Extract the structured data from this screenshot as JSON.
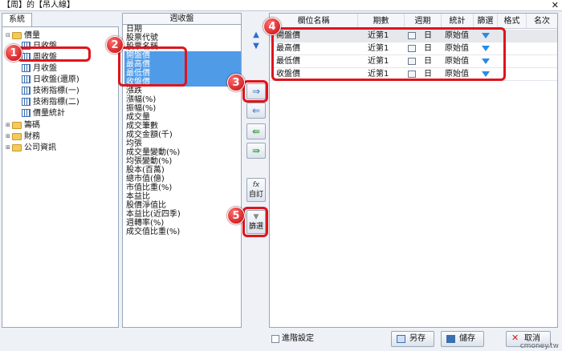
{
  "window": {
    "title": "【周】的【吊人線】",
    "close": "✕"
  },
  "tree": {
    "tab": "系統",
    "nodes": [
      {
        "label": "價量",
        "kind": "folder",
        "expand": "⊟"
      },
      {
        "label": "日收盤",
        "kind": "item"
      },
      {
        "label": "周收盤",
        "kind": "item"
      },
      {
        "label": "月收盤",
        "kind": "item"
      },
      {
        "label": "日收盤(還原)",
        "kind": "item"
      },
      {
        "label": "技術指標(一)",
        "kind": "item"
      },
      {
        "label": "技術指標(二)",
        "kind": "item"
      },
      {
        "label": "價量統計",
        "kind": "item"
      },
      {
        "label": "籌碼",
        "kind": "folder",
        "expand": "⊞"
      },
      {
        "label": "財務",
        "kind": "folder",
        "expand": "⊞"
      },
      {
        "label": "公司資訊",
        "kind": "folder",
        "expand": "⊞"
      }
    ]
  },
  "middle": {
    "header": "週收盤",
    "items": [
      "日期",
      "股票代號",
      "股票名稱",
      "開盤價",
      "最高價",
      "最低價",
      "收盤價",
      "漲跌",
      "漲幅(%)",
      "振幅(%)",
      "成交量",
      "成交筆數",
      "成交金額(千)",
      "均張",
      "成交量變動(%)",
      "均張變動(%)",
      "股本(百萬)",
      "總市值(億)",
      "市值比重(%)",
      "本益比",
      "股價淨值比",
      "本益比(近四季)",
      "週轉率(%)",
      "成交值比重(%)"
    ]
  },
  "buttons": {
    "up": "▲",
    "down": "▼",
    "add": "⇒",
    "remove": "⇐",
    "add_all": "⇚",
    "remove_all": "⇛",
    "custom_icon": "fx",
    "custom": "自訂",
    "filter_icon": "▼",
    "filter": "篩選"
  },
  "grid": {
    "headers": [
      "欄位名稱",
      "期數",
      "週期",
      "統計",
      "篩選",
      "格式",
      "名次"
    ],
    "rows": [
      {
        "name": "開盤價",
        "period": "近第1",
        "cycle": "日",
        "stat": "原始值"
      },
      {
        "name": "最高價",
        "period": "近第1",
        "cycle": "日",
        "stat": "原始值"
      },
      {
        "name": "最低價",
        "period": "近第1",
        "cycle": "日",
        "stat": "原始值"
      },
      {
        "name": "收盤價",
        "period": "近第1",
        "cycle": "日",
        "stat": "原始值"
      }
    ]
  },
  "badges": [
    "1",
    "2",
    "3",
    "4",
    "5"
  ],
  "bottom": {
    "advanced": "進階設定",
    "save_as": "另存",
    "save": "儲存",
    "cancel": "取消"
  },
  "watermark": "cmoney.tw",
  "colors": {
    "highlight": "#e0141c",
    "selection": "#4f9be8"
  }
}
